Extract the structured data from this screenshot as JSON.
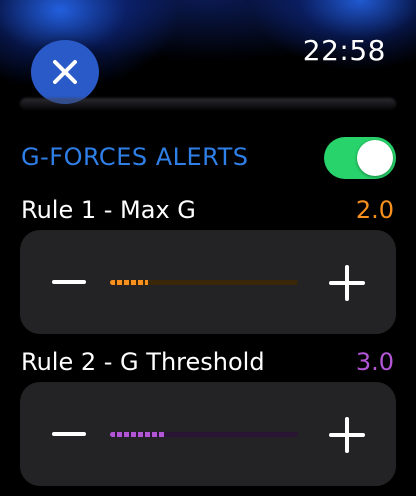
{
  "status_bar": {
    "time": "22:58"
  },
  "header": {
    "close_icon": "close-icon"
  },
  "section": {
    "title": "G-FORCES ALERTS",
    "toggle_on": true,
    "toggle_color": "#28d36b"
  },
  "rules": [
    {
      "label": "Rule 1 - Max G",
      "value": "2.0",
      "value_color": "#f7901e",
      "track_color": "#3a2608",
      "level_fraction": 0.2
    },
    {
      "label": "Rule 2 - G Threshold",
      "value": "3.0",
      "value_color": "#b356d6",
      "track_color": "#2a1433",
      "level_fraction": 0.3
    }
  ],
  "colors": {
    "section_title": "#2f7fe8",
    "stepper_bg": "#232325",
    "close_button": "#2a5ac8"
  }
}
